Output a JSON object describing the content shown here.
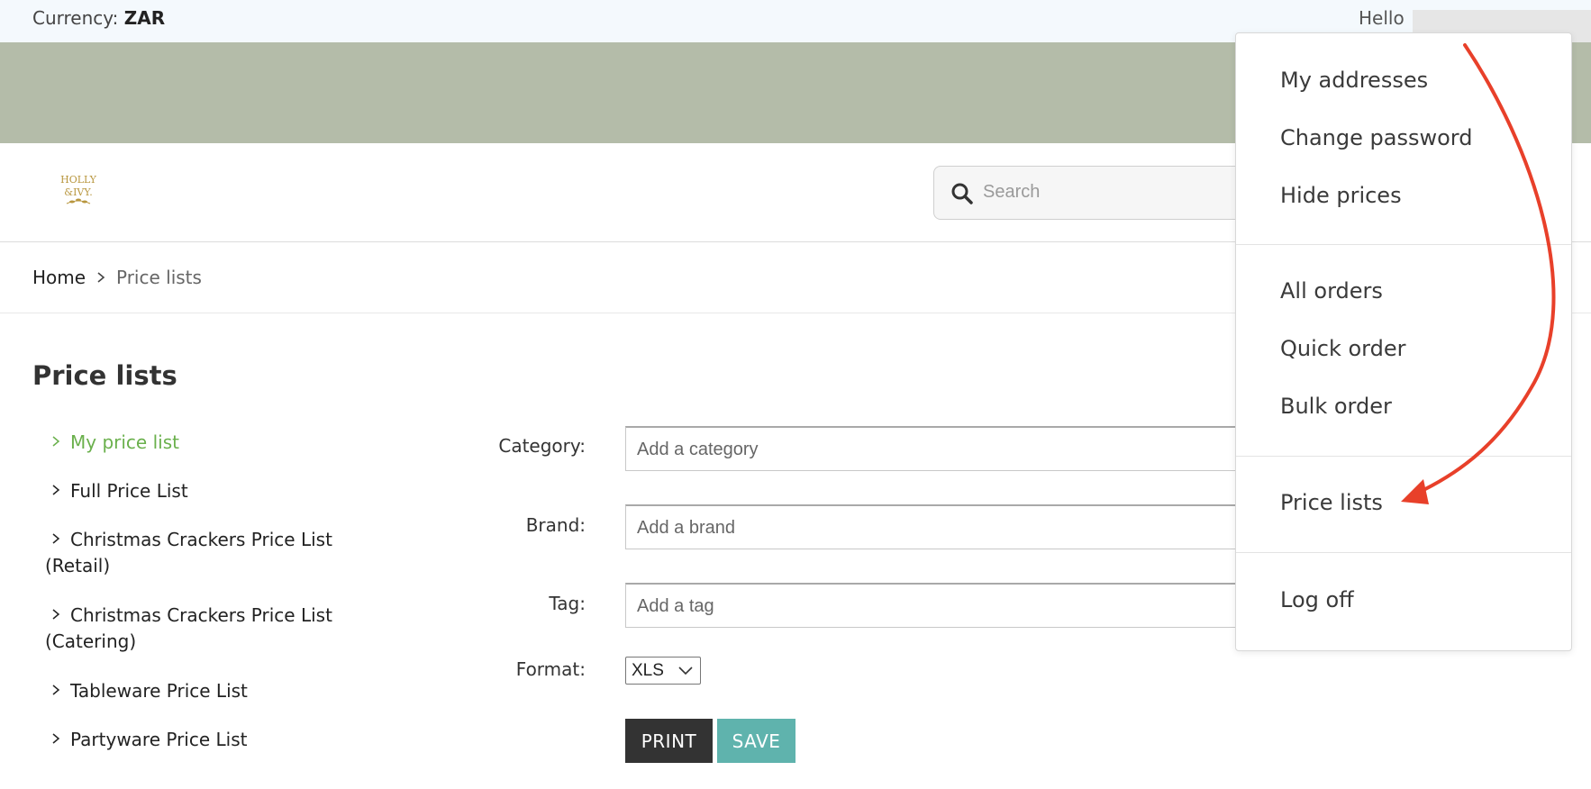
{
  "topbar": {
    "currency_label": "Currency:",
    "currency_value": "ZAR",
    "hello": "Hello"
  },
  "header": {
    "logo_text_top": "HOLLY",
    "logo_text_bottom": "&IVY.",
    "search_placeholder": "Search"
  },
  "breadcrumb": {
    "home": "Home",
    "current": "Price lists"
  },
  "page": {
    "title": "Price lists"
  },
  "price_lists": [
    {
      "label": "My price list",
      "active": true
    },
    {
      "label": "Full Price List",
      "active": false
    },
    {
      "label": "Christmas Crackers Price List",
      "label2": "(Retail)",
      "active": false
    },
    {
      "label": "Christmas Crackers Price List",
      "label2": "(Catering)",
      "active": false
    },
    {
      "label": "Tableware Price List",
      "active": false
    },
    {
      "label": "Partyware Price List",
      "active": false
    }
  ],
  "form": {
    "category_label": "Category:",
    "category_placeholder": "Add a category",
    "brand_label": "Brand:",
    "brand_placeholder": "Add a brand",
    "tag_label": "Tag:",
    "tag_placeholder": "Add a tag",
    "format_label": "Format:",
    "format_value": "XLS",
    "print_label": "PRINT",
    "save_label": "SAVE"
  },
  "account_menu": {
    "group1": [
      "My addresses",
      "Change password",
      "Hide prices"
    ],
    "group2": [
      "All orders",
      "Quick order",
      "Bulk order"
    ],
    "group3": [
      "Price lists"
    ],
    "group4": [
      "Log off"
    ]
  },
  "colors": {
    "banner": "#b4bca9",
    "active_link": "#6ab04c",
    "print_button": "#333333",
    "save_button": "#5fb3ad",
    "annotation_arrow": "#e8402a",
    "logo_gold": "#b8963e"
  }
}
